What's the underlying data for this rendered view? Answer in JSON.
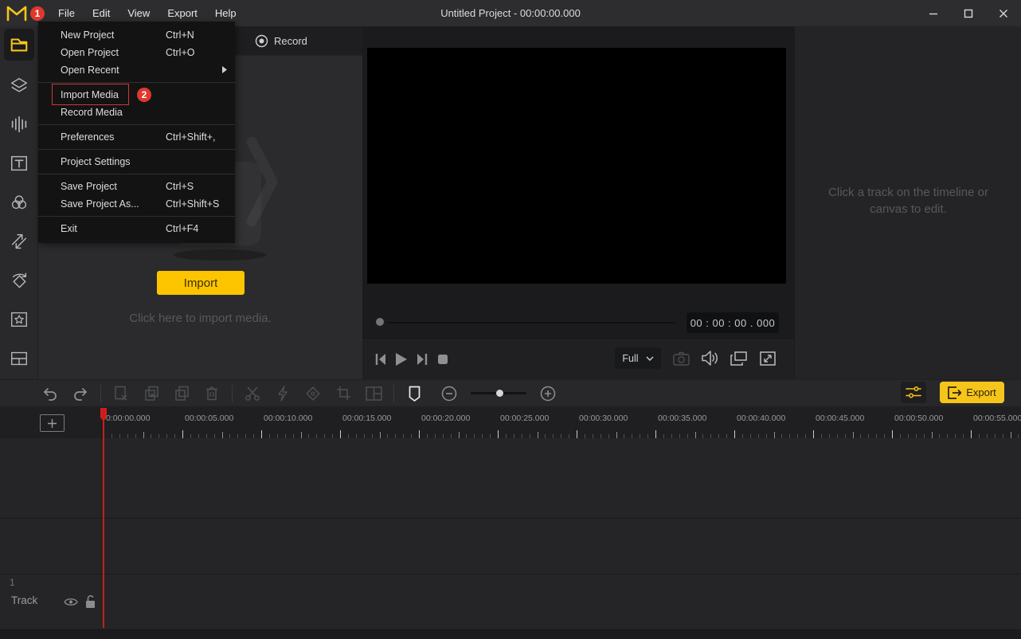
{
  "titlebar": {
    "badge_step1": "1",
    "menus": [
      "File",
      "Edit",
      "View",
      "Export",
      "Help"
    ],
    "title": "Untitled Project - 00:00:00.000"
  },
  "file_menu": {
    "badge_step2": "2",
    "items": [
      {
        "label": "New Project",
        "shortcut": "Ctrl+N"
      },
      {
        "label": "Open Project",
        "shortcut": "Ctrl+O"
      },
      {
        "label": "Open Recent",
        "shortcut": ""
      },
      {
        "label": "Import Media",
        "shortcut": ""
      },
      {
        "label": "Record Media",
        "shortcut": ""
      },
      {
        "label": "Preferences",
        "shortcut": "Ctrl+Shift+,"
      },
      {
        "label": "Project Settings",
        "shortcut": ""
      },
      {
        "label": "Save Project",
        "shortcut": "Ctrl+S"
      },
      {
        "label": "Save Project As...",
        "shortcut": "Ctrl+Shift+S"
      },
      {
        "label": "Exit",
        "shortcut": "Ctrl+F4"
      }
    ]
  },
  "sidebar": {
    "icons": [
      "media-folder",
      "elements-layers",
      "audio-waveform",
      "text",
      "filters",
      "transitions",
      "motion",
      "effects",
      "split-screen"
    ]
  },
  "media_panel": {
    "record_label": "Record",
    "import_button": "Import",
    "hint": "Click here to import media."
  },
  "preview": {
    "time_display": "00 : 00 : 00 . 000",
    "zoom_select_value": "Full"
  },
  "right_panel": {
    "hint_line1": "Click a track on the timeline or",
    "hint_line2": "canvas to edit."
  },
  "toolbar": {
    "export_label": "Export",
    "icons": [
      "undo",
      "redo",
      "cut-clip",
      "copy",
      "duplicate",
      "delete",
      "split",
      "quick-split",
      "keyframe",
      "crop",
      "split-screen",
      "marker",
      "zoom-out",
      "zoom-in"
    ]
  },
  "timeline": {
    "ruler_labels": [
      "0:00:00.000",
      "00:00:05.000",
      "00:00:10.000",
      "00:00:15.000",
      "00:00:20.000",
      "00:00:25.000",
      "00:00:30.000",
      "00:00:35.000",
      "00:00:40.000",
      "00:00:45.000",
      "00:00:50.000",
      "00:00:55.000"
    ],
    "track": {
      "number": "1",
      "name": "Track"
    }
  },
  "colors": {
    "accent_yellow": "#f6c51b",
    "badge_red": "#e0382e",
    "playhead_red": "#c81e1e"
  }
}
